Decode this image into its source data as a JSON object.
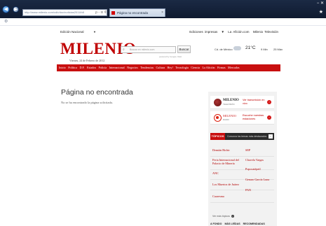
{
  "browser": {
    "back_icon": "arrow-left-icon",
    "forward_icon": "arrow-right-icon",
    "address": "http://www.milenio.com/cdb/doc/noticias2011/b8",
    "address_controls": "ρ - ≅ ¢ ×",
    "tab_title": "Página no encontrada",
    "tab_close": "×",
    "window_controls": "− ✕",
    "favorites": "★",
    "command_gear": "⚙"
  },
  "header": {
    "edition": "Edición Nacional",
    "edition_caret": "▼",
    "links": [
      "Ediciones impresas",
      "▼",
      "La Afición.com",
      "Milenio Televisión"
    ],
    "logo": "MILENIO",
    "date": "Viernes, 24 de Febrero de 2012",
    "search_placeholder": "Buscar en milenio.com",
    "search_button": "Buscar",
    "search_powered": "powered by Google | Web",
    "weather_city": "Cd. de México",
    "temperature": "21°C",
    "temp_min": "9 Min",
    "temp_max": "25 Máx"
  },
  "nav": {
    "items": [
      "Inicio",
      "Política",
      "D.F.",
      "Estados",
      "Policía",
      "Internacional",
      "Negocios",
      "Tendencias",
      "Cultura",
      "Hey!",
      "Tecnología",
      "Ciencia",
      "La Afición",
      "Firmas",
      "Mercados"
    ]
  },
  "main": {
    "title": "Página no encontrada",
    "message": "No se ha encontrado la página solicitada."
  },
  "sidebar": {
    "tv_logo": "MILENIO",
    "tv_sub": "TELEVISIÓN",
    "tv_text": "Ver transmisión en vivo",
    "radio_logo": "MILENIO",
    "radio_sub": "RADIO",
    "radio_text": "Escuche nuestras estaciones",
    "promo_arrow": "›",
    "topics_label": "TÓPICOS",
    "topics_sub": "Conozca los temas más destacados",
    "topics_btn": "›",
    "topics_left": [
      "Demián Bichir",
      "Feria Internacional del Palacio de Minería",
      "ANC",
      "Los Muertos de Juárez",
      "Cuaresma"
    ],
    "topics_right": [
      "SEP",
      "Chavela Vargas",
      "Popocatépetl",
      "Genaro García Luna",
      "PAN"
    ],
    "more_topics": "Ver más tópicos",
    "more_icon": "›",
    "bottom_tabs": [
      "A FONDO",
      "MÁS LEÍDAS",
      "RECOMENDADAS"
    ]
  }
}
